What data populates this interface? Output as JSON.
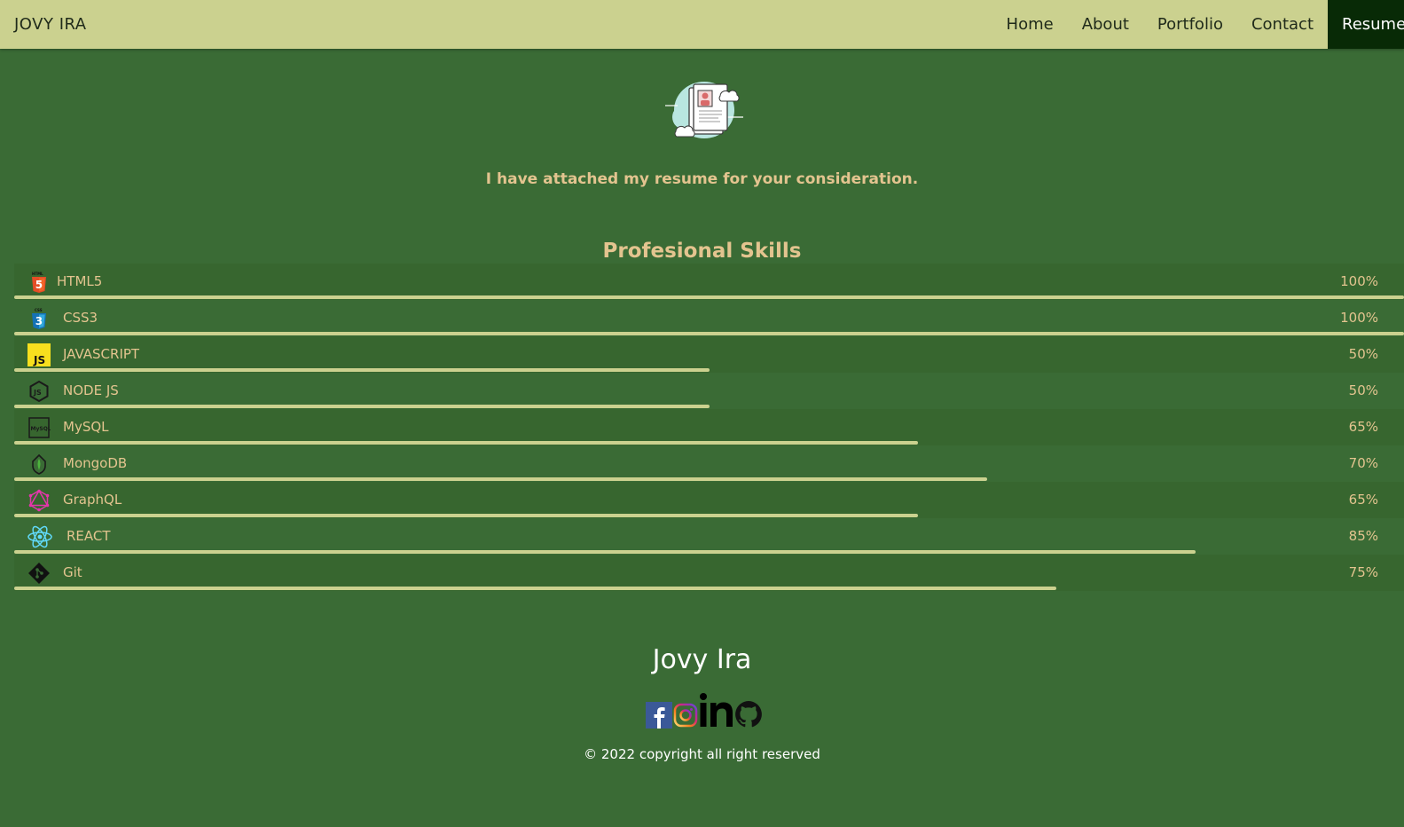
{
  "navbar": {
    "brand": "JOVY IRA",
    "links": [
      {
        "label": "Home"
      },
      {
        "label": "About"
      },
      {
        "label": "Portfolio"
      },
      {
        "label": "Contact"
      },
      {
        "label": "Resume",
        "active": true
      }
    ]
  },
  "hero": {
    "icon": "resume-document-icon",
    "intro": "I have attached my resume for your consideration."
  },
  "skills": {
    "title": "Profesional Skills",
    "items": [
      {
        "name": "HTML5",
        "percent_label": "100%",
        "level": 100,
        "icon": "html5-icon"
      },
      {
        "name": "CSS3",
        "percent_label": "100%",
        "level": 100,
        "icon": "css3-icon"
      },
      {
        "name": "JAVASCRIPT",
        "percent_label": "50%",
        "level": 50,
        "icon": "javascript-icon"
      },
      {
        "name": "NODE JS",
        "percent_label": "50%",
        "level": 50,
        "icon": "nodejs-icon"
      },
      {
        "name": "MySQL",
        "percent_label": "65%",
        "level": 65,
        "icon": "mysql-icon"
      },
      {
        "name": "MongoDB",
        "percent_label": "70%",
        "level": 70,
        "icon": "mongodb-icon"
      },
      {
        "name": "GraphQL",
        "percent_label": "65%",
        "level": 65,
        "icon": "graphql-icon"
      },
      {
        "name": "REACT",
        "percent_label": "85%",
        "level": 85,
        "icon": "react-icon"
      },
      {
        "name": "Git",
        "percent_label": "75%",
        "level": 75,
        "icon": "git-icon"
      }
    ]
  },
  "footer": {
    "name": "Jovy Ira",
    "social": [
      "facebook-icon",
      "instagram-icon",
      "linkedin-icon",
      "github-icon"
    ],
    "copyright": "© 2022 copyright all right reserved"
  },
  "colors": {
    "navbar_bg": "#cbd18f",
    "page_bg": "#3a6b35",
    "active_nav_bg": "#082a06",
    "accent_text": "#e3c48f",
    "bar_color": "#cbd18f"
  }
}
